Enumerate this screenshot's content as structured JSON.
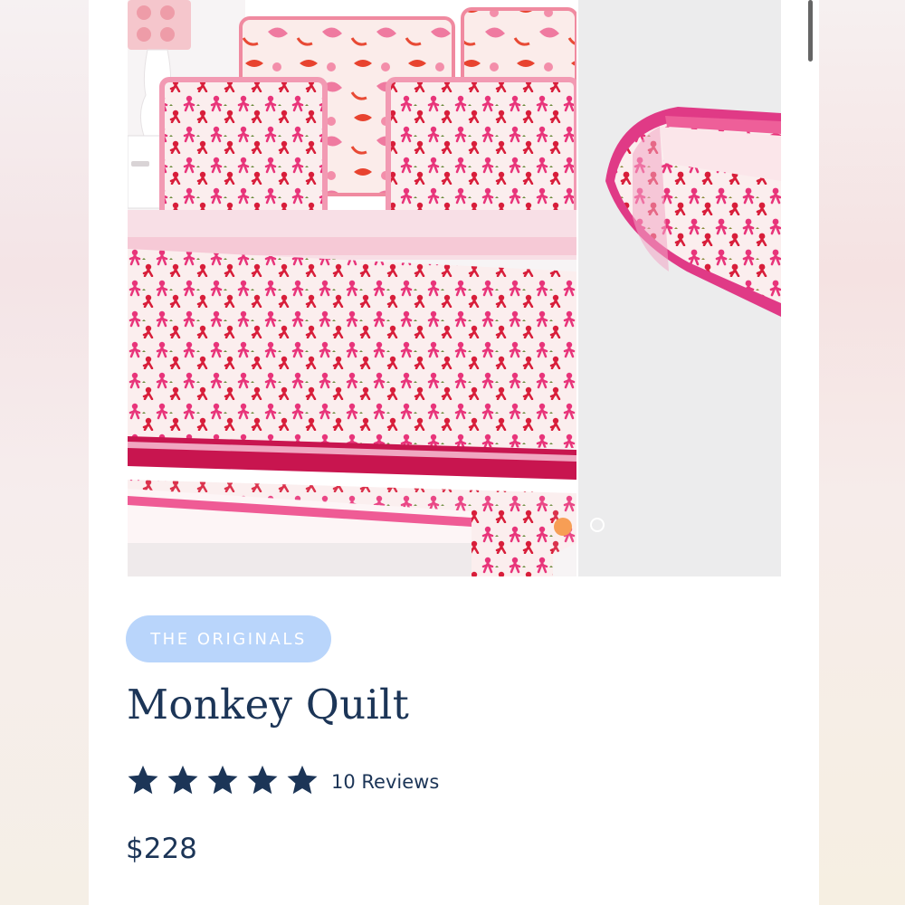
{
  "product": {
    "collection_badge": "THE ORIGINALS",
    "title": "Monkey Quilt",
    "rating": {
      "stars": 5,
      "max": 5,
      "reviews_label": "10 Reviews"
    },
    "price": "$228"
  },
  "gallery": {
    "slide_count": 2,
    "active_slide": 1,
    "images": [
      "monkey-quilt-bed-photo",
      "monkey-quilt-folded-photo"
    ]
  },
  "colors": {
    "text_navy": "#1c3557",
    "badge_blue": "#b9d5fb",
    "dot_active": "#f79e55",
    "quilt_pink": "#e8347a",
    "quilt_red": "#d81e3a",
    "quilt_cream": "#fbeeee"
  }
}
